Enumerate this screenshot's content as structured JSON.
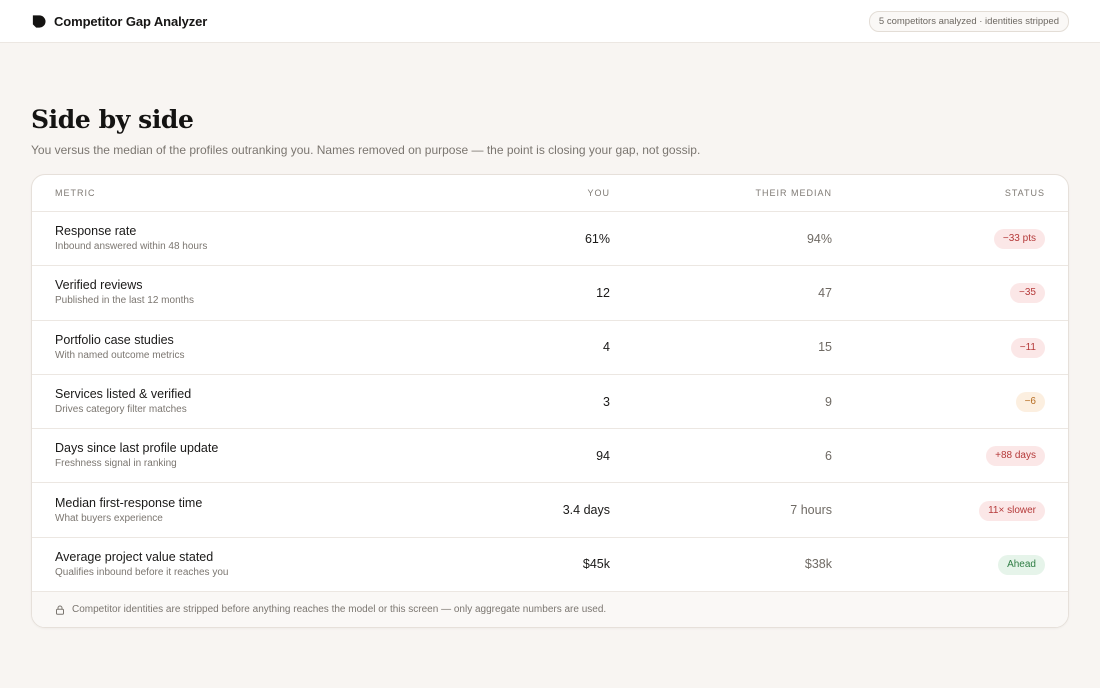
{
  "app": {
    "title": "Competitor Gap Analyzer",
    "badge": "5 competitors analyzed · identities stripped"
  },
  "page": {
    "title": "Side by side",
    "subtitle": "You versus the median of the profiles outranking you. Names removed on purpose — the point is closing your gap, not gossip."
  },
  "table": {
    "headers": {
      "metric": "Metric",
      "you": "You",
      "median": "Their median",
      "status": "Status"
    },
    "rows": [
      {
        "name": "Response rate",
        "desc": "Inbound answered within 48 hours",
        "you": "61%",
        "median": "94%",
        "status": "−33 pts",
        "tone": "neg"
      },
      {
        "name": "Verified reviews",
        "desc": "Published in the last 12 months",
        "you": "12",
        "median": "47",
        "status": "−35",
        "tone": "neg"
      },
      {
        "name": "Portfolio case studies",
        "desc": "With named outcome metrics",
        "you": "4",
        "median": "15",
        "status": "−11",
        "tone": "neg"
      },
      {
        "name": "Services listed & verified",
        "desc": "Drives category filter matches",
        "you": "3",
        "median": "9",
        "status": "−6",
        "tone": "warn"
      },
      {
        "name": "Days since last profile update",
        "desc": "Freshness signal in ranking",
        "you": "94",
        "median": "6",
        "status": "+88 days",
        "tone": "neg"
      },
      {
        "name": "Median first-response time",
        "desc": "What buyers experience",
        "you": "3.4 days",
        "median": "7 hours",
        "status": "11× slower",
        "tone": "neg"
      },
      {
        "name": "Average project value stated",
        "desc": "Qualifies inbound before it reaches you",
        "you": "$45k",
        "median": "$38k",
        "status": "Ahead",
        "tone": "pos"
      }
    ],
    "footer_note": "Competitor identities are stripped before anything reaches the model or this screen — only aggregate numbers are used."
  },
  "colors": {
    "negative": "#b53a3a",
    "warning": "#b66d22",
    "positive": "#2f7d44"
  },
  "icons": {
    "brand": "brand-logo-icon",
    "footer": "lock-icon"
  }
}
